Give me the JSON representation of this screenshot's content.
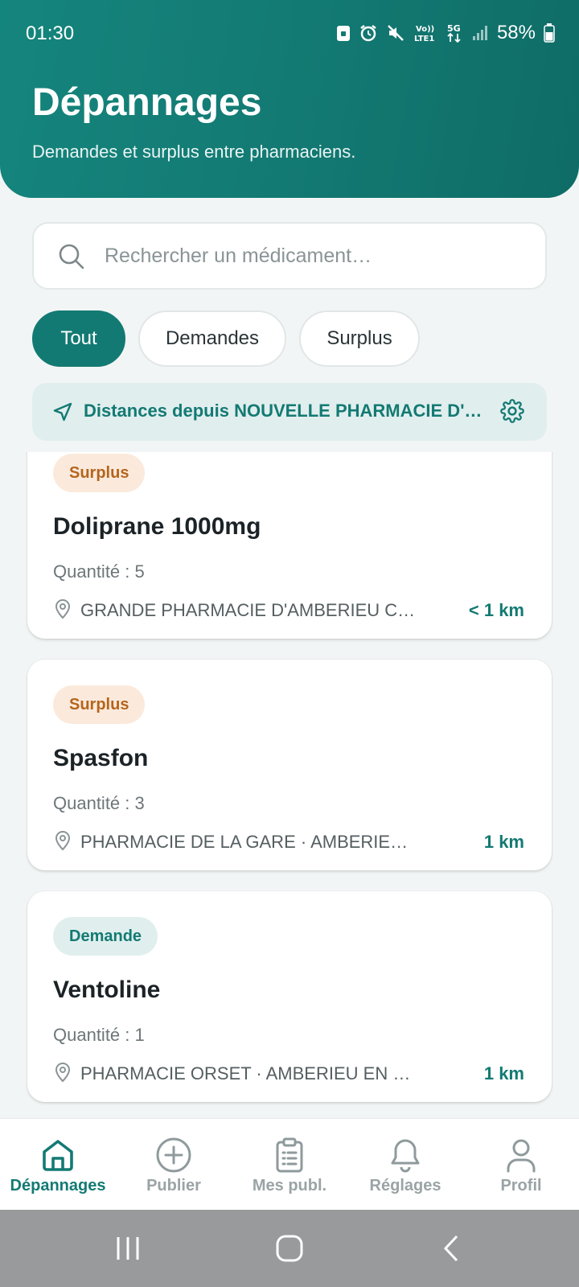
{
  "status_bar": {
    "time": "01:30",
    "network_label": "5G",
    "volte_label": "Vo)) LTE1",
    "battery_percent": "58%",
    "icons": [
      "lock-notification-icon",
      "alarm-icon",
      "mute-icon",
      "volte-icon",
      "5g-icon",
      "signal-icon",
      "battery-icon"
    ]
  },
  "header": {
    "title": "Dépannages",
    "subtitle": "Demandes et surplus entre pharmaciens."
  },
  "search": {
    "placeholder": "Rechercher un médicament…",
    "value": ""
  },
  "filters": [
    {
      "label": "Tout",
      "active": true
    },
    {
      "label": "Demandes",
      "active": false
    },
    {
      "label": "Surplus",
      "active": false
    }
  ],
  "location": {
    "text": "Distances depuis NOUVELLE PHARMACIE D'AMBERIEU"
  },
  "items": [
    {
      "type_label": "Surplus",
      "type": "surplus",
      "name": "Doliprane 1000mg",
      "quantity": "Quantité : 5",
      "pharmacy": "GRANDE PHARMACIE D'AMBERIEU CENTRE",
      "distance": "< 1 km"
    },
    {
      "type_label": "Surplus",
      "type": "surplus",
      "name": "Spasfon",
      "quantity": "Quantité : 3",
      "pharmacy": "PHARMACIE DE LA GARE · AMBERIEU EN BUGEY",
      "distance": "1 km"
    },
    {
      "type_label": "Demande",
      "type": "demande",
      "name": "Ventoline",
      "quantity": "Quantité : 1",
      "pharmacy": "PHARMACIE ORSET · AMBERIEU EN BUGEY",
      "distance": "1 km"
    }
  ],
  "bottom_nav": [
    {
      "label": "Dépannages",
      "icon": "home-icon",
      "active": true
    },
    {
      "label": "Publier",
      "icon": "plus-circle-icon",
      "active": false
    },
    {
      "label": "Mes publ.",
      "icon": "clipboard-icon",
      "active": false
    },
    {
      "label": "Réglages",
      "icon": "bell-icon",
      "active": false
    },
    {
      "label": "Profil",
      "icon": "user-icon",
      "active": false
    }
  ],
  "colors": {
    "primary": "#137a73",
    "surplus_badge_bg": "#fbeadc",
    "surplus_badge_text": "#b5651d",
    "demande_badge_bg": "#e0efee",
    "background": "#f2f5f5"
  }
}
